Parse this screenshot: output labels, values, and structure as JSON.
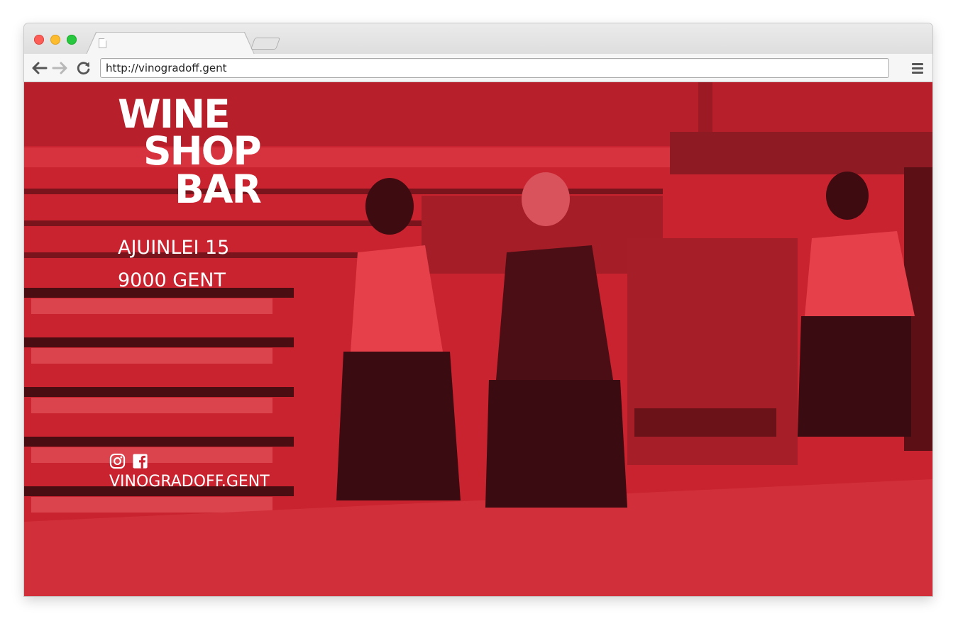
{
  "browser": {
    "url": "http://vinogradoff.gent"
  },
  "page": {
    "background_color": "#c8232f",
    "logo": {
      "line1": "WINE",
      "line2": "SHOP",
      "line3": "BAR"
    },
    "address": {
      "street": "AJUINLEI 15",
      "city": "9000 GENT"
    },
    "social_icons": [
      "instagram-icon",
      "facebook-icon"
    ],
    "website": "VINOGRADOFF.GENT"
  }
}
